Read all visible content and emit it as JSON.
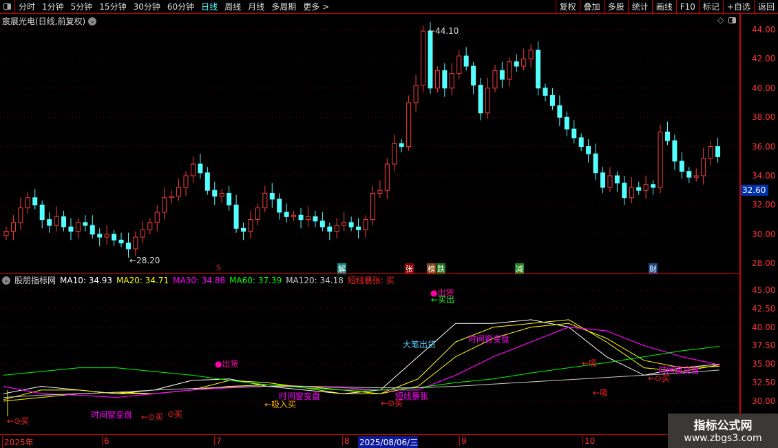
{
  "toolbar": {
    "periods": [
      "分时",
      "1分钟",
      "5分钟",
      "15分钟",
      "30分钟",
      "60分钟",
      "日线",
      "周线",
      "月线",
      "多周期",
      "更多 >"
    ],
    "active": "日线",
    "right_buttons": [
      "复权",
      "叠加",
      "多股",
      "统计",
      "画线",
      "F10",
      "标记",
      "+自选",
      "返回"
    ]
  },
  "stock": {
    "title": "宸展光电(日线,前复权)",
    "current_price_tag": "32.60",
    "high_label": "44.10",
    "low_label": "28.20"
  },
  "price_axis": [
    "44.00",
    "42.00",
    "40.00",
    "38.00",
    "36.00",
    "34.00",
    "32.00",
    "30.00",
    "28.00"
  ],
  "events": [
    {
      "label": "S",
      "color": "#000"
    },
    {
      "label": "解",
      "color": "#188a8a"
    },
    {
      "label": "张",
      "color": "#8b0000"
    },
    {
      "label": "榜",
      "color": "#8b4513"
    },
    {
      "label": "跌",
      "color": "#1f7a1f"
    },
    {
      "label": "减",
      "color": "#1f8a1f"
    },
    {
      "label": "财",
      "color": "#1a4a8a"
    }
  ],
  "indicator": {
    "name": "股朋指标网",
    "ma10": "MA10: 34.93",
    "ma20": "MA20: 34.71",
    "ma30": "MA30: 34.88",
    "ma60": "MA60: 37.39",
    "ma120": "MA120: 34.18",
    "signal": "短线暴张: 买"
  },
  "indicator_axis": [
    "45.00",
    "42.50",
    "40.00",
    "37.50",
    "35.00",
    "32.50",
    "30.00"
  ],
  "annotations": {
    "sell1": "●出货",
    "sell2": "●出货",
    "buyout": "←买出",
    "big_sell": "大笔出货",
    "window1": "时间窗变盘",
    "window2": "时间窗变盘",
    "window3": "时间窗变盘",
    "window4": "时间窗变盘",
    "buy1": "←⊙买",
    "buy2": "←⊙买",
    "buy3": "⊙买",
    "buy4": "←⊙买",
    "buy5": "←⊙买",
    "suck1": "←吸",
    "suck2": "←吸",
    "burst": "短线暴张",
    "buyin": "←吸入买"
  },
  "xaxis": {
    "labels": [
      "2025年",
      "6",
      "7",
      "8",
      "9",
      "10"
    ],
    "cursor_date": "2025/08/06/三"
  },
  "watermark": {
    "title": "指标公式网",
    "url": "www.zbgs3.com"
  },
  "chart_data": {
    "type": "candlestick",
    "ylim": [
      28,
      44
    ],
    "closes": [
      30.2,
      30.8,
      31.8,
      32.5,
      32.0,
      31.0,
      30.6,
      31.2,
      30.5,
      30.2,
      30.8,
      30.6,
      30.0,
      29.8,
      30.0,
      29.6,
      29.4,
      29.0,
      29.8,
      30.3,
      30.8,
      31.5,
      32.5,
      32.6,
      33.2,
      34.0,
      34.8,
      34.2,
      33.0,
      32.6,
      32.8,
      32.0,
      30.4,
      30.2,
      31.0,
      31.8,
      32.8,
      32.4,
      31.5,
      31.2,
      31.3,
      31.0,
      31.2,
      30.9,
      30.5,
      30.2,
      30.6,
      30.8,
      30.5,
      30.3,
      31.0,
      32.8,
      33.0,
      34.8,
      36.2,
      36.0,
      39.0,
      40.2,
      43.9,
      40.0,
      41.2,
      40.0,
      41.0,
      42.2,
      41.5,
      40.2,
      38.3,
      40.0,
      41.2,
      40.6,
      41.8,
      41.5,
      42.0,
      42.6,
      40.0,
      39.5,
      38.8,
      38.0,
      37.2,
      36.6,
      36.0,
      35.5,
      34.2,
      33.2,
      34.0,
      33.5,
      32.5,
      33.2,
      33.0,
      33.4,
      33.2,
      37.0,
      36.4,
      35.0,
      34.3,
      33.9,
      34.0,
      35.2,
      36.0,
      35.3
    ],
    "ma_series": {
      "ma5": [
        31,
        32,
        31.5,
        31,
        31.5,
        32.8,
        33,
        32,
        31.5,
        31,
        31.5,
        36,
        40.5,
        40.5,
        41,
        40,
        36,
        33.5,
        34.5,
        35
      ],
      "ma10": [
        30.2,
        31.5,
        31.5,
        31,
        31,
        31.5,
        32.8,
        32.5,
        31.8,
        31,
        31,
        33,
        38,
        40,
        40.5,
        41,
        38,
        34.5,
        34,
        34.9
      ],
      "ma20": [
        30,
        30.5,
        31,
        31.2,
        31,
        31.5,
        32,
        32.2,
        32,
        31.5,
        31,
        32,
        36,
        38.5,
        40,
        40.5,
        38.5,
        35.5,
        34.5,
        34.7
      ],
      "ma30": [
        32,
        31,
        30.8,
        30.5,
        31,
        31.5,
        31.8,
        32,
        32,
        31.8,
        31.5,
        31.5,
        33.5,
        36,
        38,
        40,
        39.5,
        37.5,
        36,
        34.9
      ],
      "ma60": [
        33.5,
        34,
        34.5,
        34.5,
        34,
        33.5,
        32.8,
        32.2,
        31.8,
        31.5,
        31.5,
        31.8,
        32.5,
        33,
        33.8,
        34.5,
        35.2,
        36,
        36.8,
        37.4
      ],
      "ma120": [
        30.5,
        30.8,
        31,
        31.2,
        31.5,
        31.7,
        31.9,
        32,
        32,
        31.9,
        31.8,
        31.8,
        32,
        32.3,
        32.6,
        32.9,
        33.2,
        33.5,
        33.8,
        34.2
      ]
    }
  }
}
